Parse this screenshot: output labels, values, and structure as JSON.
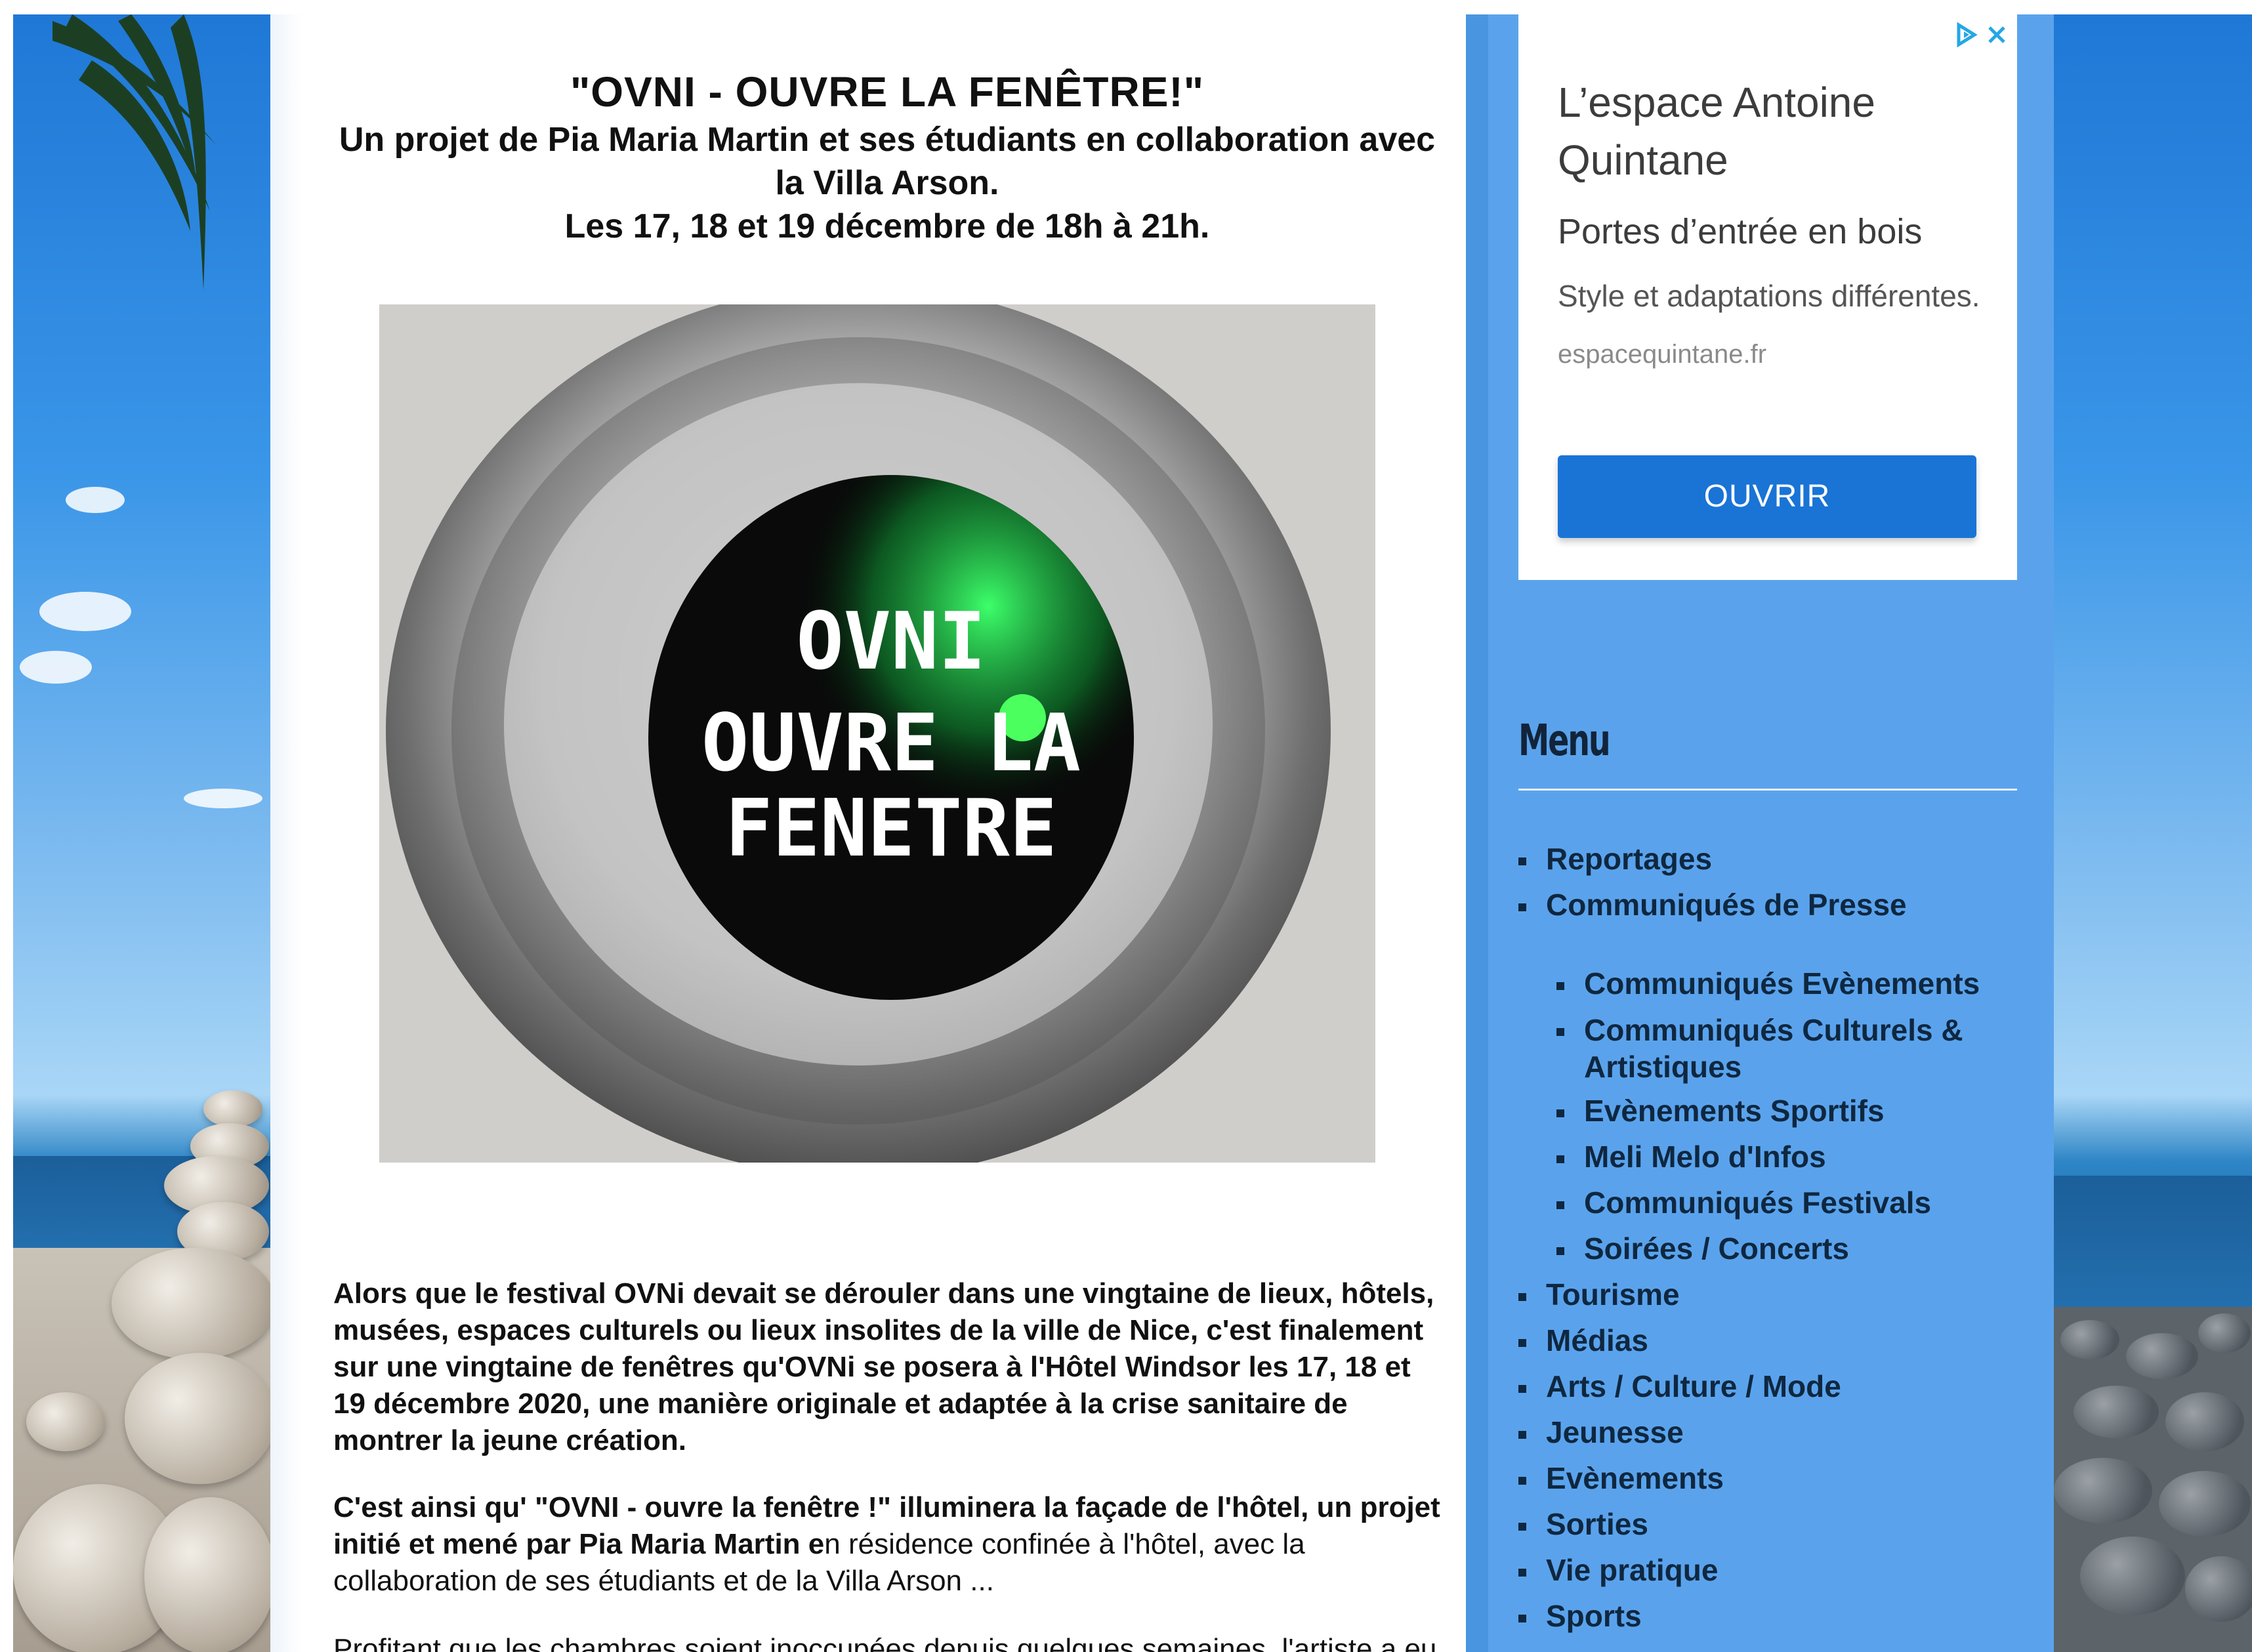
{
  "article": {
    "title": "\"OVNI - OUVRE LA FENÊTRE!\"",
    "subtitle_line1": "Un projet de Pia Maria Martin et ses étudiants en collaboration avec",
    "subtitle_line2": "la Villa Arson.",
    "dates": "Les 17, 18 et 19 décembre de 18h à 21h.",
    "hero_image": {
      "line1": "OVNI",
      "line2": "OUVRE LA",
      "line3": "FENETRE"
    },
    "paragraph1": "Alors que le festival OVNi devait se dérouler dans une vingtaine de lieux, hôtels, musées, espaces culturels ou lieux insolites de la ville de Nice, c'est finalement sur une vingtaine de fenêtres qu'OVNi se posera à l'Hôtel Windsor les 17, 18 et 19 décembre 2020, une manière originale et adaptée à la crise sanitaire de montrer la jeune création.",
    "paragraph2_bold": "C'est ainsi qu' \"OVNI - ouvre la fenêtre !\" illuminera la façade de l'hôtel, un projet initié et mené par Pia Maria Martin e",
    "paragraph2_regular": "n résidence confinée à l'hôtel, avec la collaboration de ses étudiants et de la Villa Arson ...",
    "paragraph3": "Profitant que les chambres soient inoccupées depuis quelques semaines, l'artiste a eu l'idée"
  },
  "ad": {
    "title": "L’espace Antoine Quintane",
    "subtitle": "Portes d’entrée en bois",
    "description": "Style et adaptations différentes.",
    "url": "espacequintane.fr",
    "button": "OUVRIR",
    "adchoices_icon": "adchoices-icon",
    "close_icon": "close-icon",
    "accent_color": "#1a74d6"
  },
  "menu": {
    "title": "Menu",
    "items": [
      {
        "label": "Reportages",
        "level": 0
      },
      {
        "label": "Communiqués de Presse",
        "level": 0
      },
      {
        "label": "Communiqués Evènements",
        "level": 1
      },
      {
        "label": "Communiqués Culturels & Artistiques",
        "level": 1
      },
      {
        "label": "Evènements Sportifs",
        "level": 1
      },
      {
        "label": "Meli Melo d'Infos",
        "level": 1
      },
      {
        "label": "Communiqués Festivals",
        "level": 1
      },
      {
        "label": "Soirées / Concerts",
        "level": 1
      },
      {
        "label": "Tourisme",
        "level": 0
      },
      {
        "label": "Médias",
        "level": 0
      },
      {
        "label": "Arts / Culture / Mode",
        "level": 0
      },
      {
        "label": "Jeunesse",
        "level": 0
      },
      {
        "label": "Evènements",
        "level": 0
      },
      {
        "label": "Sorties",
        "level": 0
      },
      {
        "label": "Vie pratique",
        "level": 0
      },
      {
        "label": "Sports",
        "level": 0
      }
    ]
  },
  "colors": {
    "sidebar_bg": "#5aa3ec",
    "menu_text": "#0f2740"
  }
}
